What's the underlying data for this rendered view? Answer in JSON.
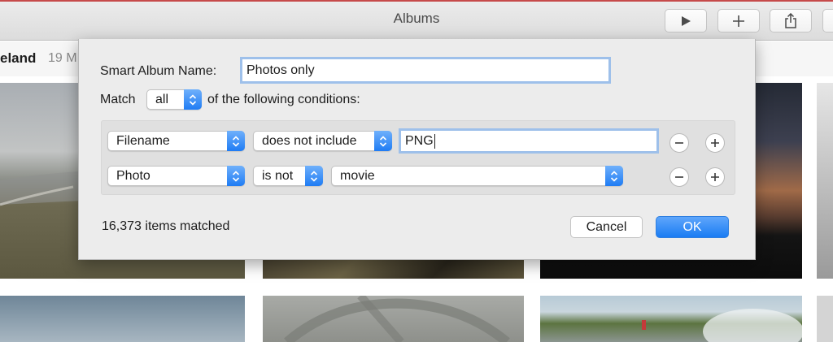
{
  "window": {
    "title": "Albums",
    "toolbar": {
      "play_icon": "play-icon",
      "add_icon": "plus-icon",
      "share_icon": "share-icon"
    }
  },
  "subheader": {
    "title": "eland",
    "count": "19 M"
  },
  "dialog": {
    "name_label": "Smart Album Name:",
    "name_value": "Photos only",
    "match_label": "Match",
    "match_value": "all",
    "match_suffix": "of the following conditions:",
    "conditions": [
      {
        "field": "Filename",
        "operator": "does not include",
        "value": "PNG"
      },
      {
        "field": "Photo",
        "operator": "is not",
        "value": "movie"
      }
    ],
    "status": "16,373 items matched",
    "cancel_label": "Cancel",
    "ok_label": "OK"
  },
  "colors": {
    "accent": "#1a7cf3",
    "focus_ring": "#9ec0ea",
    "window_border": "#c64a4a"
  }
}
